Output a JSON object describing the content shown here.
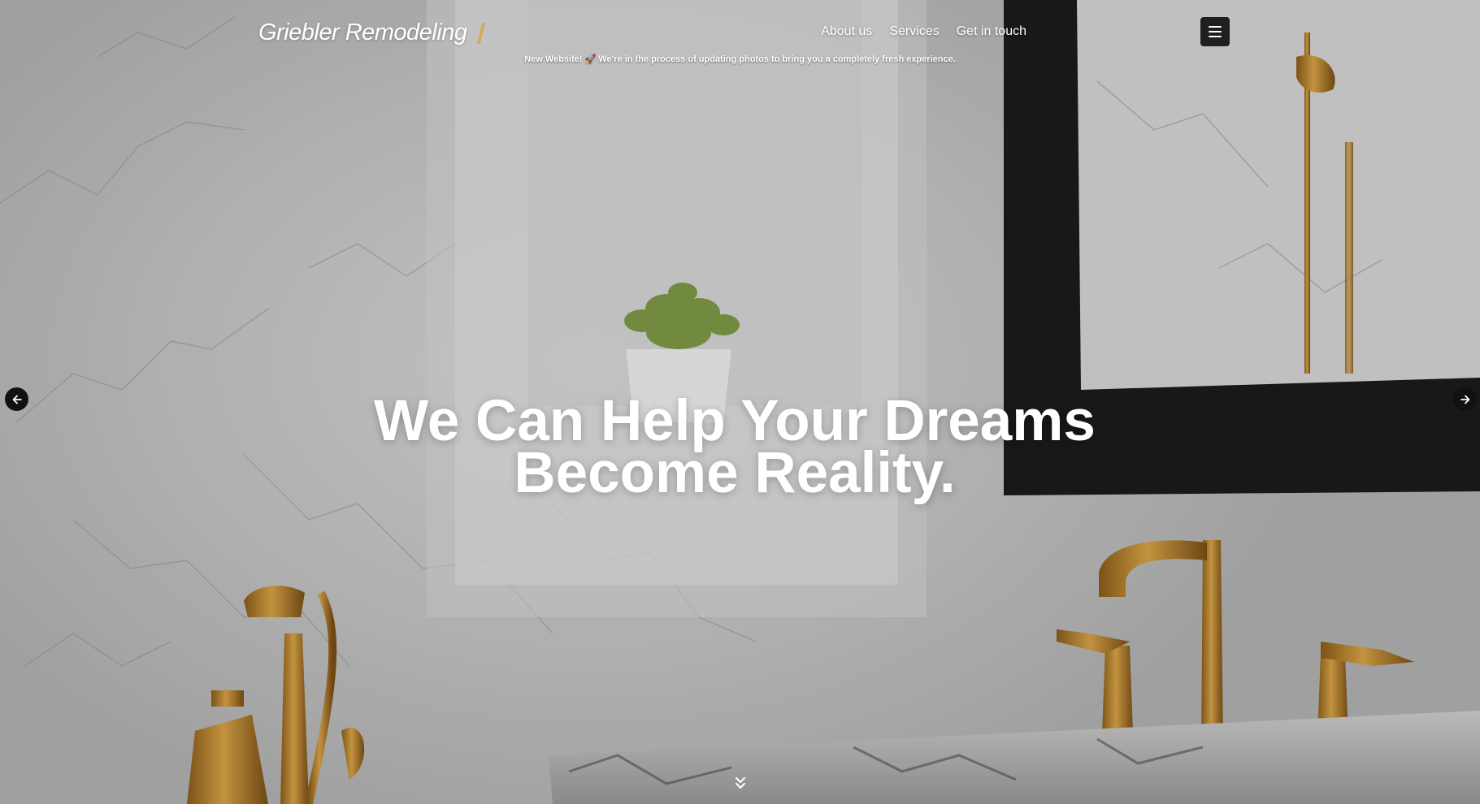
{
  "header": {
    "brand": "Griebler Remodeling",
    "nav": [
      {
        "label": "About us"
      },
      {
        "label": "Services"
      },
      {
        "label": "Get in touch"
      }
    ],
    "menu_icon": "hamburger-icon"
  },
  "notice": {
    "text": "New Website! 🚀 We're in the process of updating photos to bring you a completely fresh experience."
  },
  "hero": {
    "headline_line1": "We Can Help Your Dreams",
    "headline_line2": "Become Reality.",
    "prev_icon": "arrow-left-icon",
    "next_icon": "arrow-right-icon",
    "scroll_icon": "double-chevron-down-icon"
  },
  "colors": {
    "accent": "#d8a64a",
    "button_dark": "#1f1f1f",
    "text_light": "#ffffff"
  }
}
